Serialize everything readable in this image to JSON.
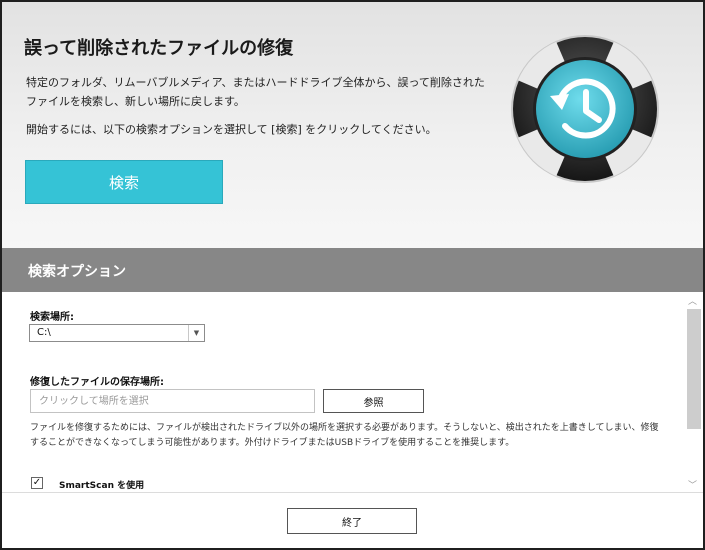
{
  "window": {
    "title": "誤って削除されたファイルの修復",
    "description": "特定のフォルダ、リムーバブルメディア、またはハードドライブ全体から、誤って削除されたファイルを検索し、新しい場所に戻します。",
    "hint": "開始するには、以下の検索オプションを選択して [検索] をクリックしてください。",
    "search_button": "検索"
  },
  "options": {
    "title": "検索オプション",
    "location_label": "検索場所:",
    "location_value": "C:\\",
    "save_label": "修復したファイルの保存場所:",
    "save_placeholder": "クリックして場所を選択",
    "browse_button": "参照",
    "notice": "ファイルを修復するためには、ファイルが検出されたドライブ以外の場所を選択する必要があります。そうしないと、検出されたを上書きしてしまい、修復することができなくなってしまう可能性があります。外付けドライブまたはUSBドライブを使用することを推奨します。",
    "smartscan_check": "✓",
    "smartscan_label": "SmartScan を使用"
  },
  "footer": {
    "close_button": "終了"
  },
  "colors": {
    "accent": "#35c3d6",
    "section_bar": "#878787"
  },
  "icons": {
    "logo": "lifebuoy-restore-icon",
    "dropdown": "chevron-down-icon",
    "scroll_up": "chevron-up-icon",
    "scroll_down": "chevron-down-icon"
  }
}
